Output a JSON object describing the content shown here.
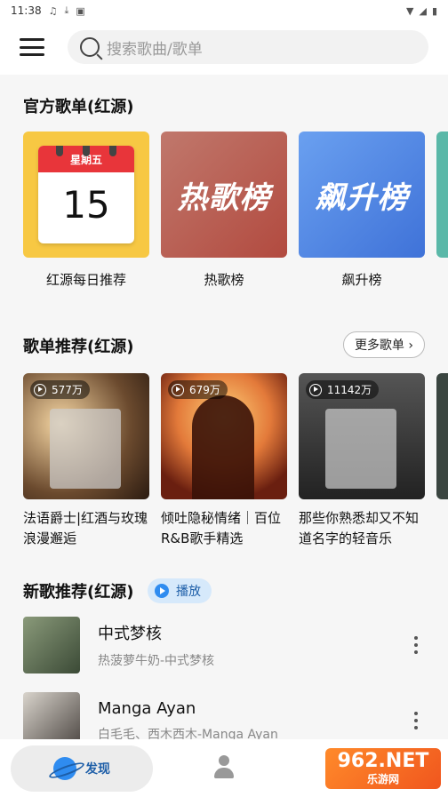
{
  "status": {
    "time": "11:38"
  },
  "search": {
    "placeholder": "搜索歌曲/歌单"
  },
  "official": {
    "title": "官方歌单(红源)",
    "cards": [
      {
        "label": "红源每日推荐",
        "weekday": "星期五",
        "day": "15"
      },
      {
        "label": "热歌榜",
        "cover_text": "热歌榜"
      },
      {
        "label": "飙升榜",
        "cover_text": "飙升榜"
      }
    ]
  },
  "playlists": {
    "title": "歌单推荐(红源)",
    "more_label": "更多歌单 ›",
    "items": [
      {
        "plays": "577万",
        "label": "法语爵士|红酒与玫瑰浪漫邂逅"
      },
      {
        "plays": "679万",
        "label": "倾吐隐秘情绪｜百位R&B歌手精选"
      },
      {
        "plays": "11142万",
        "label": "那些你熟悉却又不知道名字的轻音乐"
      }
    ]
  },
  "new_songs": {
    "title": "新歌推荐(红源)",
    "play_label": "播放",
    "songs": [
      {
        "title": "中式梦核",
        "subtitle": "热菠萝牛奶-中式梦核"
      },
      {
        "title": "Manga Ayan",
        "subtitle": "白毛毛、西木西木-Manga Ayan"
      }
    ]
  },
  "nav": {
    "discover_label": "发现"
  },
  "watermark": {
    "big": "962.NET",
    "small": "乐游网"
  },
  "colors": {
    "accent": "#2f8cf0",
    "calendar_red": "#e8353a"
  }
}
